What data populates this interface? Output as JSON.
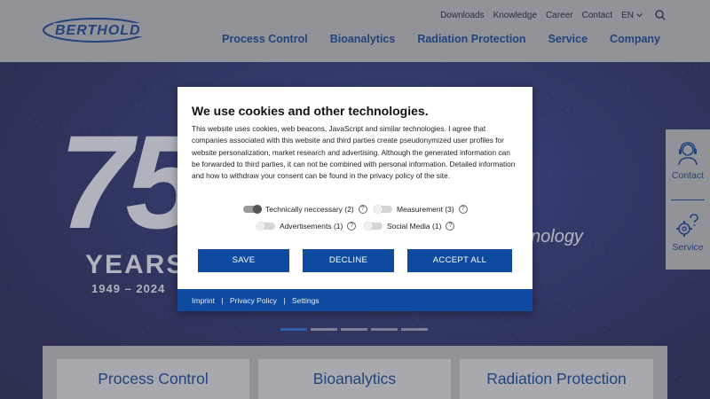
{
  "header": {
    "logo_text": "BERTHOLD",
    "top_nav": [
      "Downloads",
      "Knowledge",
      "Career",
      "Contact"
    ],
    "language": "EN",
    "main_nav": [
      "Process Control",
      "Bioanalytics",
      "Radiation Protection",
      "Service",
      "Company"
    ]
  },
  "hero": {
    "big_number": "75",
    "years_label": "YEARS",
    "year_range": "1949 – 2024",
    "tagline_fragment": "nology"
  },
  "tiles": [
    "Process Control",
    "Bioanalytics",
    "Radiation Protection"
  ],
  "side_widgets": {
    "contact_label": "Contact",
    "service_label": "Service"
  },
  "cookie_dialog": {
    "title": "We use cookies and other technologies.",
    "body": "This website uses cookies, web beacons, JavaScript and similar technologies. I agree that companies associated with this website and third parties create pseudonymized user profiles for website personalization, market research and advertising. Although the generated information can be forwarded to third parties, it can not be combined with personal information. Detailed information and how to withdraw your consent can be found in the privacy policy of the site.",
    "options": {
      "technically_necessary": "Technically neccessary (2)",
      "measurement": "Measurement (3)",
      "advertisements": "Advertisements (1)",
      "social_media": "Social Media (1)"
    },
    "buttons": {
      "save": "SAVE",
      "decline": "DECLINE",
      "accept_all": "ACCEPT ALL"
    },
    "footer": {
      "imprint": "Imprint",
      "privacy_policy": "Privacy Policy",
      "settings": "Settings"
    }
  }
}
